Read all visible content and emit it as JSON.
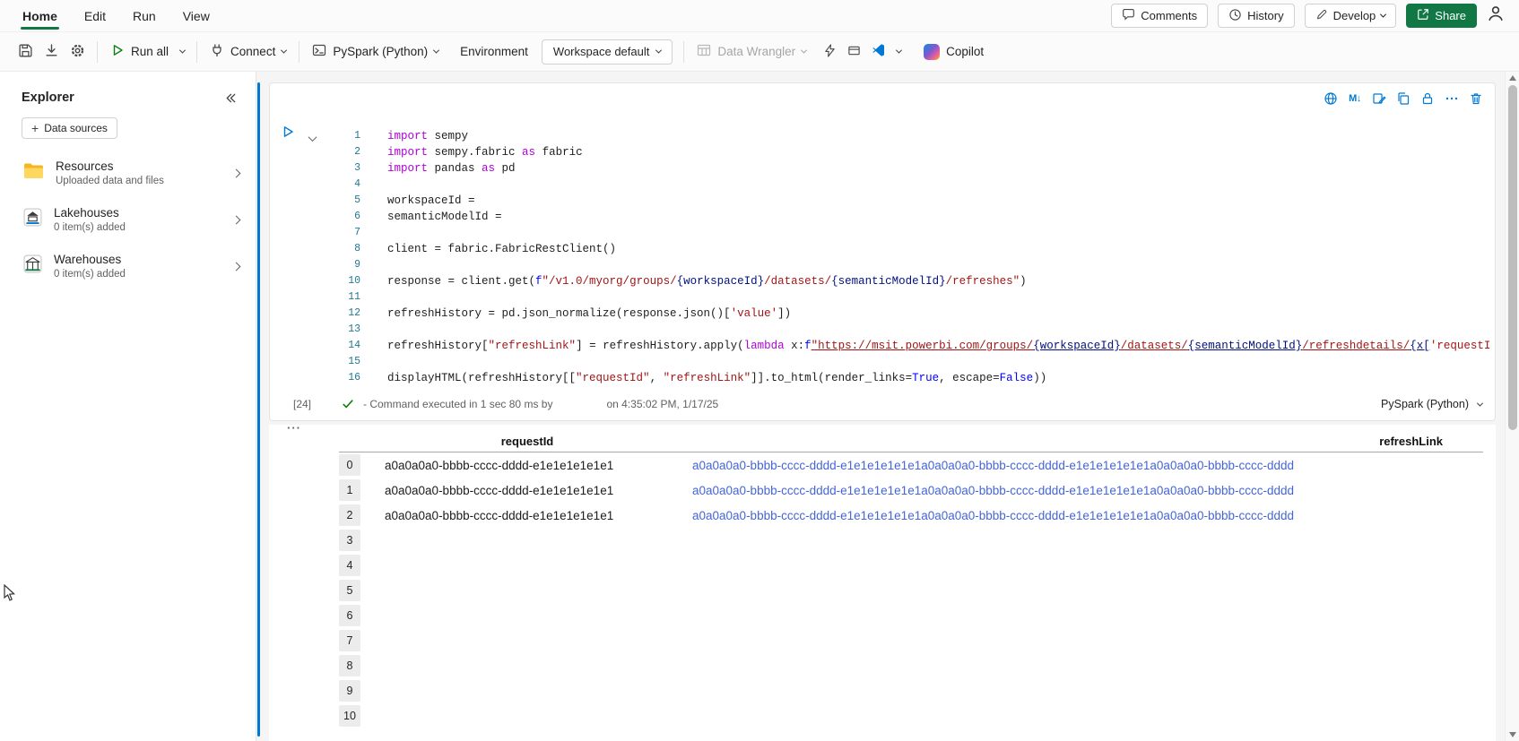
{
  "colors": {
    "theme_green": "#117845",
    "run_green": "#107c10",
    "active_cell_blue": "#0078d4",
    "link_blue": "#4565d6",
    "string_red": "#a31515",
    "keyword_purple": "#af00db"
  },
  "menubar": {
    "tabs": [
      {
        "label": "Home",
        "active": true
      },
      {
        "label": "Edit",
        "active": false
      },
      {
        "label": "Run",
        "active": false
      },
      {
        "label": "View",
        "active": false
      }
    ],
    "comments_label": "Comments",
    "history_label": "History",
    "develop_label": "Develop",
    "share_label": "Share"
  },
  "toolbar": {
    "run_all_label": "Run all",
    "connect_label": "Connect",
    "language_label": "PySpark (Python)",
    "environment_label": "Environment",
    "workspace_label": "Workspace default",
    "data_wrangler_label": "Data Wrangler",
    "copilot_label": "Copilot"
  },
  "explorer": {
    "title": "Explorer",
    "add_data_sources_label": "Data sources",
    "items": [
      {
        "label": "Resources",
        "description": "Uploaded data and files"
      },
      {
        "label": "Lakehouses",
        "description": "0 item(s) added"
      },
      {
        "label": "Warehouses",
        "description": "0 item(s) added"
      }
    ]
  },
  "cell": {
    "markdown_icon_label": "M↓",
    "execution_count": "[24]",
    "status_text": "- Command executed in 1 sec 80 ms by",
    "status_time": "on 4:35:02 PM, 1/17/25",
    "kernel_label": "PySpark (Python)",
    "code_lines": [
      [
        [
          "k",
          "import"
        ],
        [
          "p",
          " sempy"
        ]
      ],
      [
        [
          "k",
          "import"
        ],
        [
          "p",
          " sempy.fabric "
        ],
        [
          "k",
          "as"
        ],
        [
          "p",
          " fabric"
        ]
      ],
      [
        [
          "k",
          "import"
        ],
        [
          "p",
          " pandas "
        ],
        [
          "k",
          "as"
        ],
        [
          "p",
          " pd"
        ]
      ],
      [],
      [
        [
          "p",
          "workspaceId = "
        ]
      ],
      [
        [
          "p",
          "semanticModelId = "
        ]
      ],
      [],
      [
        [
          "p",
          "client = fabric.FabricRestClient()"
        ]
      ],
      [],
      [
        [
          "p",
          "response = client.get("
        ],
        [
          "b",
          "f"
        ],
        [
          "s",
          "\"/v1.0/myorg/groups/"
        ],
        [
          "v",
          "{workspaceId}"
        ],
        [
          "s",
          "/datasets/"
        ],
        [
          "v",
          "{semanticModelId}"
        ],
        [
          "s",
          "/refreshes\""
        ],
        [
          "p",
          ")"
        ]
      ],
      [],
      [
        [
          "p",
          "refreshHistory = pd.json_normalize(response.json()["
        ],
        [
          "s",
          "'value'"
        ],
        [
          "p",
          "])"
        ]
      ],
      [],
      [
        [
          "p",
          "refreshHistory["
        ],
        [
          "s",
          "\"refreshLink\""
        ],
        [
          "p",
          "] = refreshHistory.apply("
        ],
        [
          "k",
          "lambda"
        ],
        [
          "p",
          " x:"
        ],
        [
          "b",
          "f"
        ],
        [
          "su",
          "\"https://msit.powerbi.com/groups/"
        ],
        [
          "vu",
          "{workspaceId}"
        ],
        [
          "su",
          "/datasets/"
        ],
        [
          "vu",
          "{semanticModelId}"
        ],
        [
          "su",
          "/refreshdetails/"
        ],
        [
          "vu",
          "{x["
        ],
        [
          "s",
          "'requestId'"
        ],
        [
          "vu",
          "]}"
        ],
        [
          "su",
          "\""
        ],
        [
          "p",
          ")"
        ]
      ],
      [],
      [
        [
          "p",
          "displayHTML(refreshHistory[["
        ],
        [
          "s",
          "\"requestId\""
        ],
        [
          "p",
          ", "
        ],
        [
          "s",
          "\"refreshLink\""
        ],
        [
          "p",
          "]].to_html(render_links="
        ],
        [
          "b",
          "True"
        ],
        [
          "p",
          ", escape="
        ],
        [
          "b",
          "False"
        ],
        [
          "p",
          "))"
        ]
      ]
    ]
  },
  "output": {
    "collapse_dots": "···",
    "columns": [
      "requestId",
      "refreshLink"
    ],
    "rows": [
      {
        "index": "0",
        "request_id": "a0a0a0a0-bbbb-cccc-dddd-e1e1e1e1e1e1",
        "refresh_link": "a0a0a0a0-bbbb-cccc-dddd-e1e1e1e1e1e1a0a0a0a0-bbbb-cccc-dddd-e1e1e1e1e1e1a0a0a0a0-bbbb-cccc-dddd"
      },
      {
        "index": "1",
        "request_id": "a0a0a0a0-bbbb-cccc-dddd-e1e1e1e1e1e1",
        "refresh_link": "a0a0a0a0-bbbb-cccc-dddd-e1e1e1e1e1e1a0a0a0a0-bbbb-cccc-dddd-e1e1e1e1e1e1a0a0a0a0-bbbb-cccc-dddd"
      },
      {
        "index": "2",
        "request_id": "a0a0a0a0-bbbb-cccc-dddd-e1e1e1e1e1e1",
        "refresh_link": "a0a0a0a0-bbbb-cccc-dddd-e1e1e1e1e1e1a0a0a0a0-bbbb-cccc-dddd-e1e1e1e1e1e1a0a0a0a0-bbbb-cccc-dddd"
      },
      {
        "index": "3",
        "request_id": "",
        "refresh_link": ""
      },
      {
        "index": "4",
        "request_id": "",
        "refresh_link": ""
      },
      {
        "index": "5",
        "request_id": "",
        "refresh_link": ""
      },
      {
        "index": "6",
        "request_id": "",
        "refresh_link": ""
      },
      {
        "index": "7",
        "request_id": "",
        "refresh_link": ""
      },
      {
        "index": "8",
        "request_id": "",
        "refresh_link": ""
      },
      {
        "index": "9",
        "request_id": "",
        "refresh_link": ""
      },
      {
        "index": "10",
        "request_id": "",
        "refresh_link": ""
      }
    ]
  }
}
